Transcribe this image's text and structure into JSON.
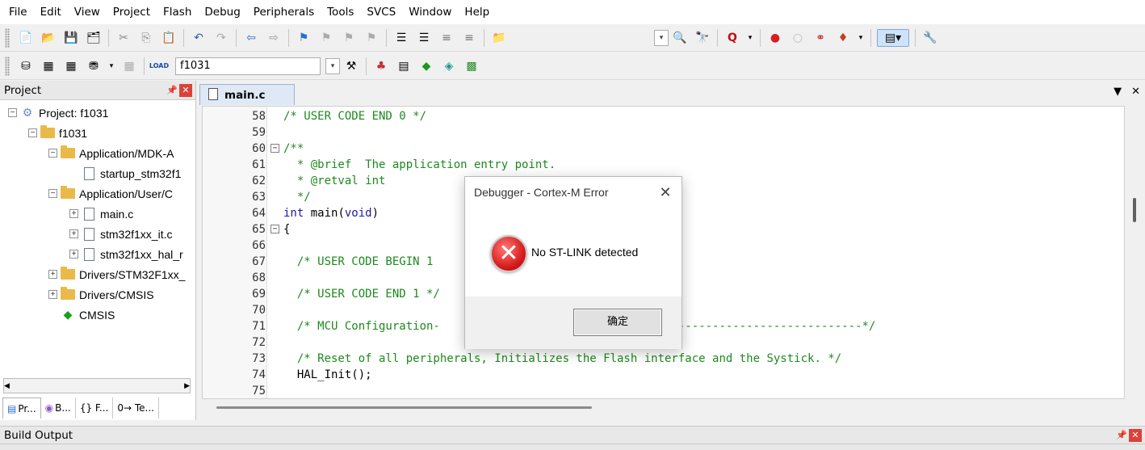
{
  "menu": [
    "File",
    "Edit",
    "View",
    "Project",
    "Flash",
    "Debug",
    "Peripherals",
    "Tools",
    "SVCS",
    "Window",
    "Help"
  ],
  "toolbar2": {
    "target": "f1031"
  },
  "project_panel": {
    "title": "Project",
    "tree": [
      {
        "label": "Project: f1031",
        "level": 0,
        "exp": "-",
        "icon": "project-icon"
      },
      {
        "label": "f1031",
        "level": 1,
        "exp": "-",
        "icon": "target-folder-icon"
      },
      {
        "label": "Application/MDK-A",
        "level": 2,
        "exp": "-",
        "icon": "folder-icon"
      },
      {
        "label": "startup_stm32f1",
        "level": 3,
        "exp": "",
        "icon": "file-icon"
      },
      {
        "label": "Application/User/C",
        "level": 2,
        "exp": "-",
        "icon": "folder-icon"
      },
      {
        "label": "main.c",
        "level": 3,
        "exp": "+",
        "icon": "file-icon"
      },
      {
        "label": "stm32f1xx_it.c",
        "level": 3,
        "exp": "+",
        "icon": "file-icon"
      },
      {
        "label": "stm32f1xx_hal_r",
        "level": 3,
        "exp": "+",
        "icon": "file-icon"
      },
      {
        "label": "Drivers/STM32F1xx_",
        "level": 2,
        "exp": "+",
        "icon": "folder-icon"
      },
      {
        "label": "Drivers/CMSIS",
        "level": 2,
        "exp": "+",
        "icon": "folder-icon"
      },
      {
        "label": "CMSIS",
        "level": 2,
        "exp": "",
        "icon": "cmsis-diamond-icon"
      }
    ],
    "tabs": [
      "Pr...",
      "B...",
      "{} F...",
      "0→ Te..."
    ]
  },
  "editor": {
    "tab": "main.c",
    "lines": [
      {
        "n": "58",
        "fold": "",
        "code": [
          {
            "t": "/* USER CODE END 0 */",
            "c": "cmt"
          }
        ]
      },
      {
        "n": "59",
        "fold": "",
        "code": []
      },
      {
        "n": "60",
        "fold": "-",
        "code": [
          {
            "t": "/**",
            "c": "cmt"
          }
        ]
      },
      {
        "n": "61",
        "fold": "",
        "code": [
          {
            "t": "  * @brief  The application entry point.",
            "c": "cmt"
          }
        ]
      },
      {
        "n": "62",
        "fold": "",
        "code": [
          {
            "t": "  * @retval int",
            "c": "cmt"
          }
        ]
      },
      {
        "n": "63",
        "fold": "",
        "code": [
          {
            "t": "  */",
            "c": "cmt"
          }
        ]
      },
      {
        "n": "64",
        "fold": "",
        "code": [
          {
            "t": "int",
            "c": "kw"
          },
          {
            "t": " main(",
            "c": ""
          },
          {
            "t": "void",
            "c": "kw"
          },
          {
            "t": ")",
            "c": ""
          }
        ]
      },
      {
        "n": "65",
        "fold": "-",
        "code": [
          {
            "t": "{",
            "c": ""
          }
        ]
      },
      {
        "n": "66",
        "fold": "",
        "code": []
      },
      {
        "n": "67",
        "fold": "",
        "code": [
          {
            "t": "  /* USER CODE BEGIN 1",
            "c": "cmt"
          }
        ]
      },
      {
        "n": "68",
        "fold": "",
        "code": []
      },
      {
        "n": "69",
        "fold": "",
        "code": [
          {
            "t": "  /* USER CODE END 1 */",
            "c": "cmt"
          }
        ]
      },
      {
        "n": "70",
        "fold": "",
        "code": []
      },
      {
        "n": "71",
        "fold": "",
        "code": [
          {
            "t": "  /* MCU Configuration-",
            "c": "cmt"
          },
          {
            "t": "                                 -----------------------------*/",
            "c": "cmt"
          }
        ]
      },
      {
        "n": "72",
        "fold": "",
        "code": []
      },
      {
        "n": "73",
        "fold": "",
        "code": [
          {
            "t": "  /* Reset of all peripherals, Initializes the Flash interface and the Systick. */",
            "c": "cmt"
          }
        ]
      },
      {
        "n": "74",
        "fold": "",
        "code": [
          {
            "t": "  HAL_Init();",
            "c": ""
          }
        ]
      },
      {
        "n": "75",
        "fold": "",
        "code": []
      }
    ]
  },
  "build_output": {
    "title": "Build Output"
  },
  "dialog": {
    "title": "Debugger - Cortex-M Error",
    "message": "No ST-LINK detected",
    "ok_label": "确定"
  }
}
